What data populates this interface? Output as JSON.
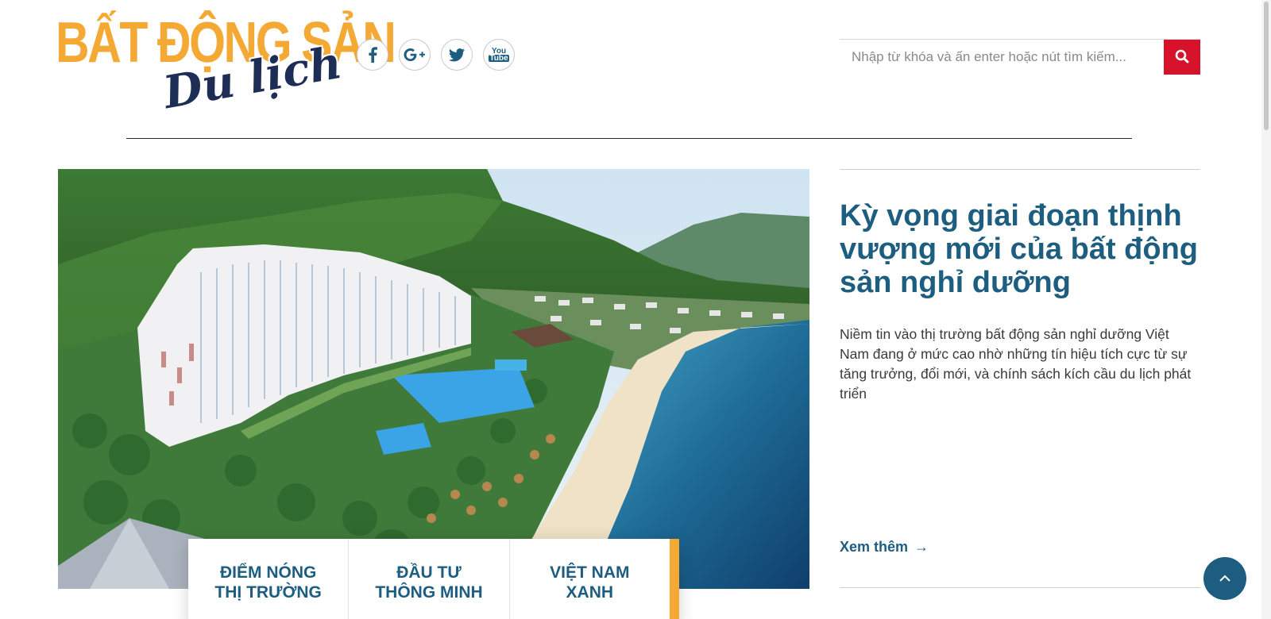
{
  "brand": {
    "logo_main": "BẤT ĐỘNG SẢN",
    "logo_script": "Du lịch",
    "logo_color": "#f4a934",
    "logo_script_color": "#1e2d55"
  },
  "social": [
    {
      "name": "facebook-icon",
      "label": "f"
    },
    {
      "name": "google-plus-icon",
      "label": "G+"
    },
    {
      "name": "twitter-icon",
      "label": "twitter"
    },
    {
      "name": "youtube-icon",
      "label_top": "You",
      "label_bottom": "Tube"
    }
  ],
  "search": {
    "placeholder": "Nhập từ khóa và ấn enter hoặc nút tìm kiếm...",
    "button_icon": "search-icon",
    "button_color": "#d7132b"
  },
  "featured": {
    "title": "Kỳ vọng giai đoạn thịnh vượng mới của bất động sản nghỉ dưỡng",
    "description": "Niềm tin vào thị trường bất động sản nghỉ dưỡng Việt Nam đang ở mức cao nhờ những tín hiệu tích cực từ sự tăng trưởng, đổi mới, và chính sách kích cầu du lịch phát triển",
    "read_more": "Xem thêm",
    "read_more_arrow": "→",
    "image_desc": "resort-aerial-photo"
  },
  "categories": [
    {
      "line1": "ĐIỂM NÓNG",
      "line2": "THỊ TRƯỜNG"
    },
    {
      "line1": "ĐẦU TƯ",
      "line2": "THÔNG MINH"
    },
    {
      "line1": "VIỆT NAM",
      "line2": "XANH"
    }
  ],
  "colors": {
    "primary": "#1d5e80",
    "accent": "#f4a934",
    "search_red": "#d7132b"
  },
  "back_to_top_icon": "chevron-up-icon"
}
